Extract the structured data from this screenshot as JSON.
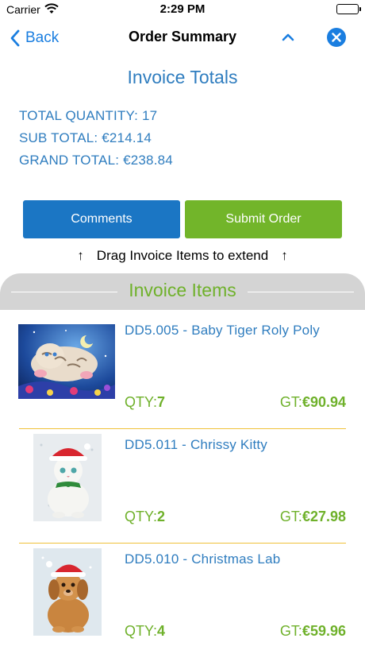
{
  "status_bar": {
    "carrier": "Carrier",
    "time": "2:29 PM"
  },
  "nav": {
    "back_label": "Back",
    "title": "Order Summary"
  },
  "totals": {
    "heading": "Invoice Totals",
    "total_quantity": "TOTAL QUANTITY: 17",
    "sub_total": "SUB TOTAL: €214.14",
    "grand_total": "GRAND TOTAL: €238.84"
  },
  "actions": {
    "comments_label": "Comments",
    "submit_label": "Submit Order"
  },
  "drag_hint": {
    "arrow": "↑",
    "text": "Drag Invoice Items to extend"
  },
  "items_panel": {
    "title": "Invoice Items",
    "items": [
      {
        "name": "DD5.005 - Baby Tiger Roly Poly",
        "qty_label": "QTY:",
        "qty": "7",
        "gt_label": "GT:",
        "gt": "€90.94"
      },
      {
        "name": "DD5.011 - Chrissy Kitty",
        "qty_label": "QTY:",
        "qty": "2",
        "gt_label": "GT:",
        "gt": "€27.98"
      },
      {
        "name": "DD5.010 - Christmas Lab",
        "qty_label": "QTY:",
        "qty": "4",
        "gt_label": "GT:",
        "gt": "€59.96"
      }
    ]
  },
  "colors": {
    "link_blue": "#1a7ee0",
    "text_blue": "#2f7dbf",
    "comments_btn": "#1b76c4",
    "submit_btn": "#72b52a",
    "green_text": "#6fb12b",
    "divider_gold": "#f0c23a",
    "panel_header_gray": "#d4d4d4"
  },
  "icons": {
    "wifi": "wifi-icon",
    "battery": "battery-icon",
    "back": "chevron-left-icon",
    "collapse": "chevron-up-icon",
    "close": "close-circle-icon"
  }
}
